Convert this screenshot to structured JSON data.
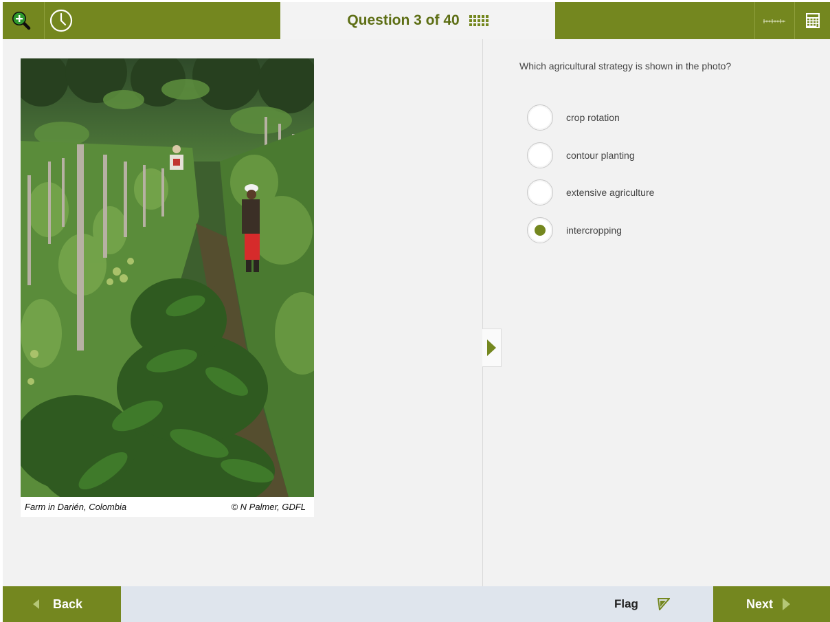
{
  "header": {
    "title": "Question 3 of 40",
    "icons": [
      "zoom-in-icon",
      "clock-icon",
      "question-grid-icon",
      "ruler-icon",
      "calculator-icon"
    ]
  },
  "stimulus": {
    "photo_subject": "Farm in Darién, Colombia",
    "caption": "Farm in Darién, Colombia",
    "credit": "© N Palmer, GDFL"
  },
  "question": {
    "prompt": "Which agricultural strategy is shown in the photo?",
    "options": [
      {
        "label": "crop rotation",
        "selected": false
      },
      {
        "label": "contour planting",
        "selected": false
      },
      {
        "label": "extensive agriculture",
        "selected": false
      },
      {
        "label": "intercropping",
        "selected": true
      }
    ]
  },
  "footer": {
    "back_label": "Back",
    "flag_label": "Flag",
    "next_label": "Next"
  },
  "colors": {
    "accent": "#74871f",
    "title_text": "#5d6e14",
    "panel_bg": "#f2f2f2",
    "footer_bg": "#dfe5ed"
  }
}
